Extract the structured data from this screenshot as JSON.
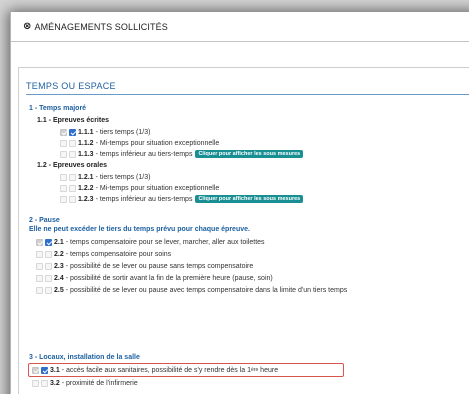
{
  "header": {
    "title": "AMÉNAGEMENTS SOLLICITÉS"
  },
  "section": {
    "title": "TEMPS OU ESPACE"
  },
  "button_label": "Cliquer pour afficher les sous mesures",
  "groups": [
    {
      "label": "1 - Temps majoré"
    },
    {
      "label": "2 - Pause",
      "note": "Elle ne peut excéder le tiers du temps prévu pour chaque épreuve."
    },
    {
      "label": "3 - Locaux, installation de la salle"
    }
  ],
  "subgroups": [
    {
      "label": "1.1 - Epreuves écrites"
    },
    {
      "label": "1.2 - Epreuves orales"
    }
  ],
  "items": {
    "i111": {
      "code": "1.1.1",
      "desc": "- tiers temps (1/3)",
      "checked": true
    },
    "i112": {
      "code": "1.1.2",
      "desc": "- Mi-temps pour situation exceptionnelle",
      "checked": false
    },
    "i113": {
      "code": "1.1.3",
      "desc": "- temps inférieur au tiers-temps",
      "checked": false
    },
    "i121": {
      "code": "1.2.1",
      "desc": "- tiers temps (1/3)",
      "checked": false
    },
    "i122": {
      "code": "1.2.2",
      "desc": "- Mi-temps pour situation exceptionnelle",
      "checked": false
    },
    "i123": {
      "code": "1.2.3",
      "desc": "- temps inférieur au tiers-temps",
      "checked": false
    },
    "i21": {
      "code": "2.1",
      "desc": "- temps compensatoire pour se lever, marcher, aller aux toilettes",
      "checked": true
    },
    "i22": {
      "code": "2.2",
      "desc": "- temps compensatoire pour soins",
      "checked": false
    },
    "i23": {
      "code": "2.3",
      "desc": "- possibilité de se lever ou pause sans temps compensatoire",
      "checked": false
    },
    "i24": {
      "code": "2.4",
      "desc": "- possibilité de sortir avant la fin de la première heure (pause, soin)",
      "checked": false
    },
    "i25": {
      "code": "2.5",
      "desc": "- possibilité de se lever ou pause avec temps compensatoire dans la limite d'un tiers temps",
      "checked": false
    },
    "i31": {
      "code": "3.1",
      "desc": "- accès facile aux sanitaires, possibilité de s'y rendre dès la 1",
      "desc_sup": "ère",
      "desc_end": " heure",
      "checked": true
    },
    "i32": {
      "code": "3.2",
      "desc": "- proximité de l'infirmerie",
      "checked": false
    }
  },
  "colors": {
    "accent": "#1c5f9f",
    "button": "#1a8f93",
    "checkbox": "#2e6fcf",
    "highlight": "#d9534f"
  },
  "icons": {
    "header": "gear-icon"
  }
}
